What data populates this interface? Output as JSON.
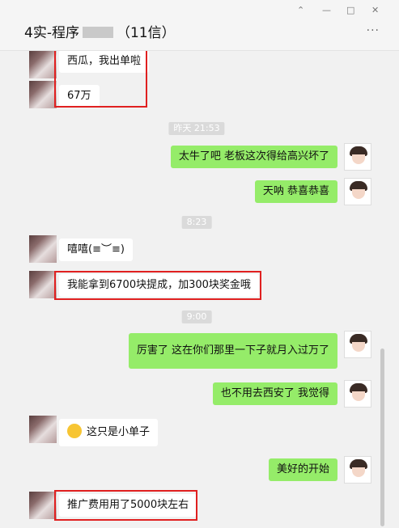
{
  "window": {
    "title_prefix": "4实-程序",
    "title_suffix": "（11信）",
    "controls": [
      "⌃",
      "—",
      "□",
      "✕"
    ],
    "more_label": "···"
  },
  "messages": {
    "m1": "西瓜，我出单啦",
    "m2": "67万",
    "t1": "昨天 21:53",
    "m3": "太牛了吧  老板这次得给高兴坏了",
    "m4": "天呐  恭喜恭喜",
    "t2": "8:23",
    "m5": "嘻嘻(≡︶≡)",
    "m6": "我能拿到6700块提成，加300块奖金哦",
    "t3": "9:00",
    "m7": "厉害了  这在你们那里一下子就月入过万了",
    "m8": "也不用去西安了  我觉得",
    "m9": "这只是小单子",
    "m10": "美好的开始",
    "m11": "推广费用用了5000块左右"
  },
  "colors": {
    "sent_bubble": "#95ec69",
    "received_bubble": "#ffffff",
    "highlight_box": "#e02020",
    "chat_background": "#f1f1f1"
  },
  "icons": {
    "emoji": "sweat-smile-emoji-icon",
    "avatar_self": "cartoon-girl-avatar-icon"
  }
}
